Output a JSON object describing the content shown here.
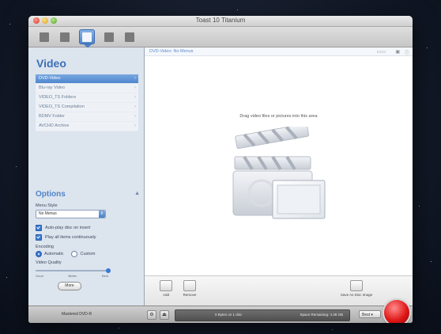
{
  "window": {
    "title": "Toast 10 Titanium"
  },
  "toolbar": {
    "active_index": 2,
    "tools": [
      "data-icon",
      "audio-icon",
      "video-icon",
      "copy-icon",
      "convert-icon"
    ]
  },
  "sidebar": {
    "heading": "Video",
    "items": [
      "DVD-Video",
      "Blu-ray Video",
      "VIDEO_TS Folders",
      "VIDEO_TS Compilation",
      "BDMV Folder",
      "AVCHD Archive"
    ],
    "selected_index": 0
  },
  "options": {
    "title": "Options",
    "menu_style_label": "Menu Style",
    "menu_style_value": "No Menus",
    "auto_play_label": "Auto-play disc on insert",
    "play_all_label": "Play all items continuously",
    "encoding_label": "Encoding",
    "encoding_auto": "Automatic",
    "encoding_custom": "Custom",
    "quality_label": "Video Quality",
    "quality_ticks": [
      "Good",
      "Better",
      "Best"
    ],
    "quality_level": 1.0,
    "more_button": "More"
  },
  "main": {
    "path": "DVD-Video: No Menus",
    "drop_hint": "Drag video files or pictures into this area"
  },
  "bottom_bar": {
    "add": "Add",
    "remove": "Remove",
    "save_disc_image": "Save As Disc Image"
  },
  "status": {
    "disc_type": "Mastered DVD-R",
    "capacity_text": "0 Bytes on 1 disc",
    "space_remaining": "Space Remaining: 4.38 GB",
    "speed": "Best"
  }
}
